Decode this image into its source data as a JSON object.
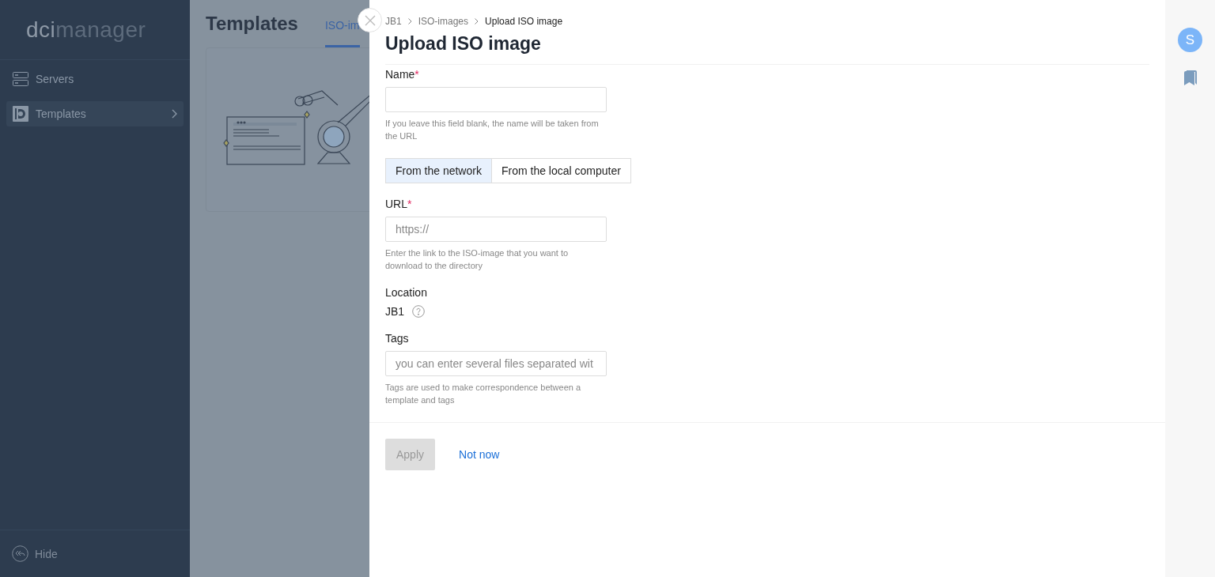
{
  "sidebar": {
    "logo": {
      "strong": "dci",
      "light": "manager"
    },
    "items": [
      {
        "label": "Servers",
        "kind": "servers",
        "selected": false
      },
      {
        "label": "Templates",
        "kind": "templates",
        "selected": true
      }
    ],
    "hide": "Hide"
  },
  "page": {
    "title": "Templates",
    "tabs": [
      {
        "label": "ISO-im",
        "selected": true
      }
    ]
  },
  "panel": {
    "breadcrumbs": [
      "JB1",
      "ISO-images",
      "Upload ISO image"
    ],
    "title": "Upload ISO image",
    "fields": [
      {
        "kind": "input",
        "label": "Name",
        "required_mark": "*",
        "hint": "If you leave this field blank, the name will be taken from the URL"
      },
      {
        "kind": "segmented",
        "options": [
          {
            "label": "From the network",
            "selected": true
          },
          {
            "label": "From the local computer",
            "selected": false
          }
        ]
      },
      {
        "kind": "input",
        "label": "URL",
        "required_mark": "*",
        "placeholder": "https://",
        "hint": "Enter the link to the ISO-image that you want to download to the directory"
      },
      {
        "kind": "static",
        "label": "Location",
        "value": "JB1",
        "help": true
      },
      {
        "kind": "input",
        "label": "Tags",
        "placeholder": "you can enter several files separated wit",
        "hint": "Tags are used to make correspondence between a template and tags"
      }
    ],
    "buttons": [
      {
        "kind": "primary",
        "label": "Apply",
        "disabled": true
      },
      {
        "kind": "link",
        "label": "Not now",
        "disabled": false
      }
    ]
  },
  "rail": {
    "avatar": "S"
  }
}
